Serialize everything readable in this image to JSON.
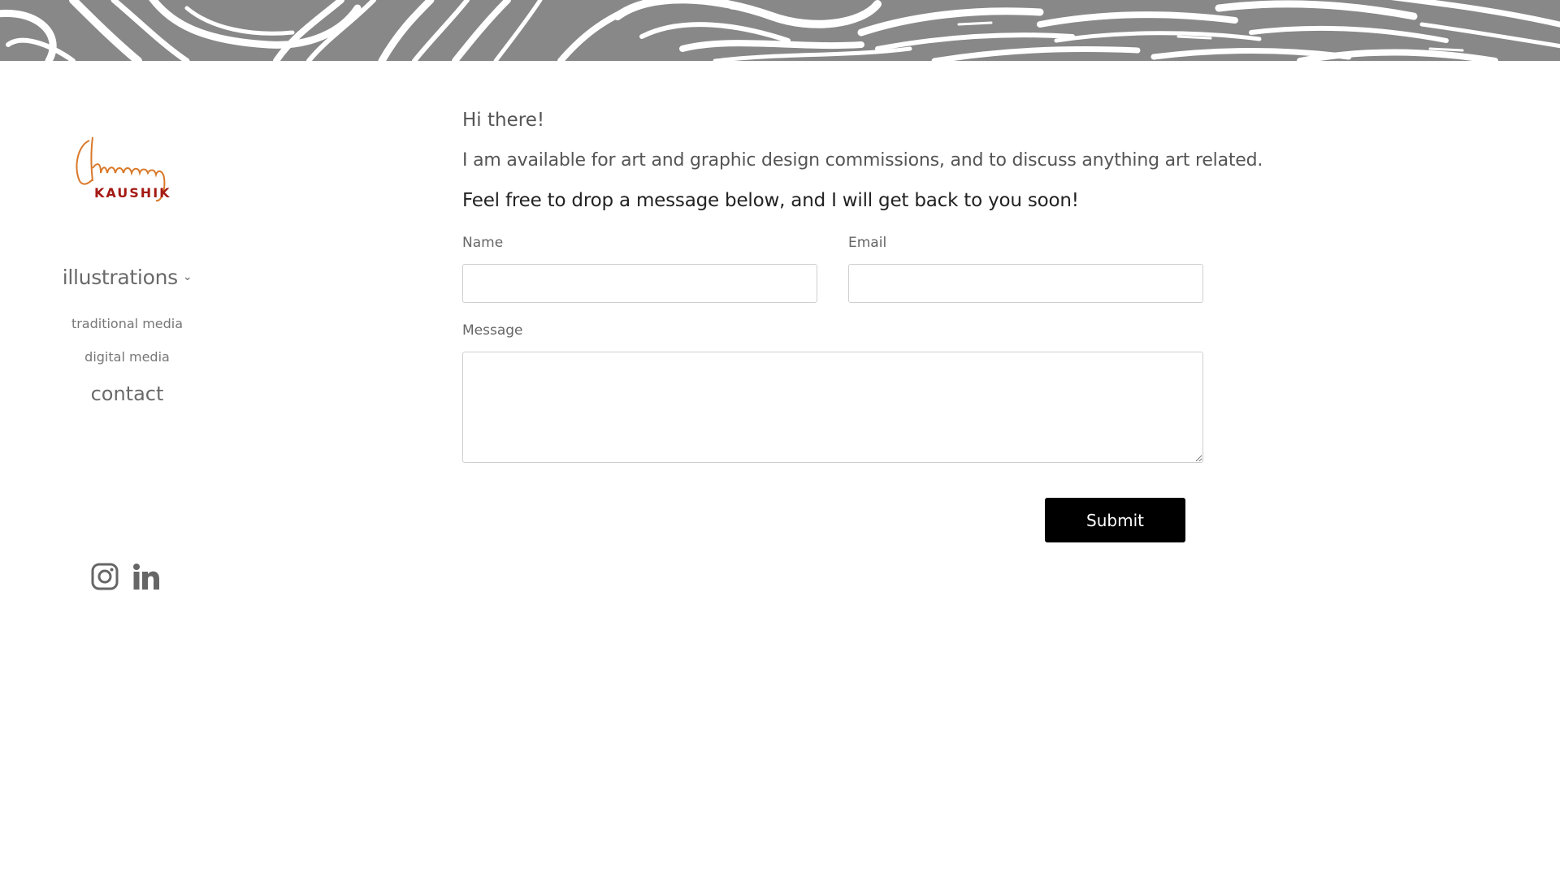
{
  "brand": {
    "logo_script": "Chinmayi",
    "logo_caps": "KAUSHIK",
    "logo_colors": {
      "script": "#d9792a",
      "caps": "#a41a14"
    }
  },
  "banner": {
    "pattern_color": "#888888"
  },
  "nav": {
    "illustrations": "illustrations",
    "chevron": "⌄",
    "traditional_media": "traditional media",
    "digital_media": "digital media",
    "contact": "contact"
  },
  "social": {
    "items": [
      {
        "icon": "instagram-icon"
      },
      {
        "icon": "linkedin-icon"
      }
    ]
  },
  "content": {
    "greeting": "Hi there!",
    "intro": "I am available for art and graphic design commissions, and to discuss anything art related.",
    "cta": "Feel free to drop a message below, and I will get back to you soon!"
  },
  "form": {
    "name_label": "Name",
    "name_value": "",
    "email_label": "Email",
    "email_value": "",
    "message_label": "Message",
    "message_value": "",
    "submit_label": "Submit"
  }
}
